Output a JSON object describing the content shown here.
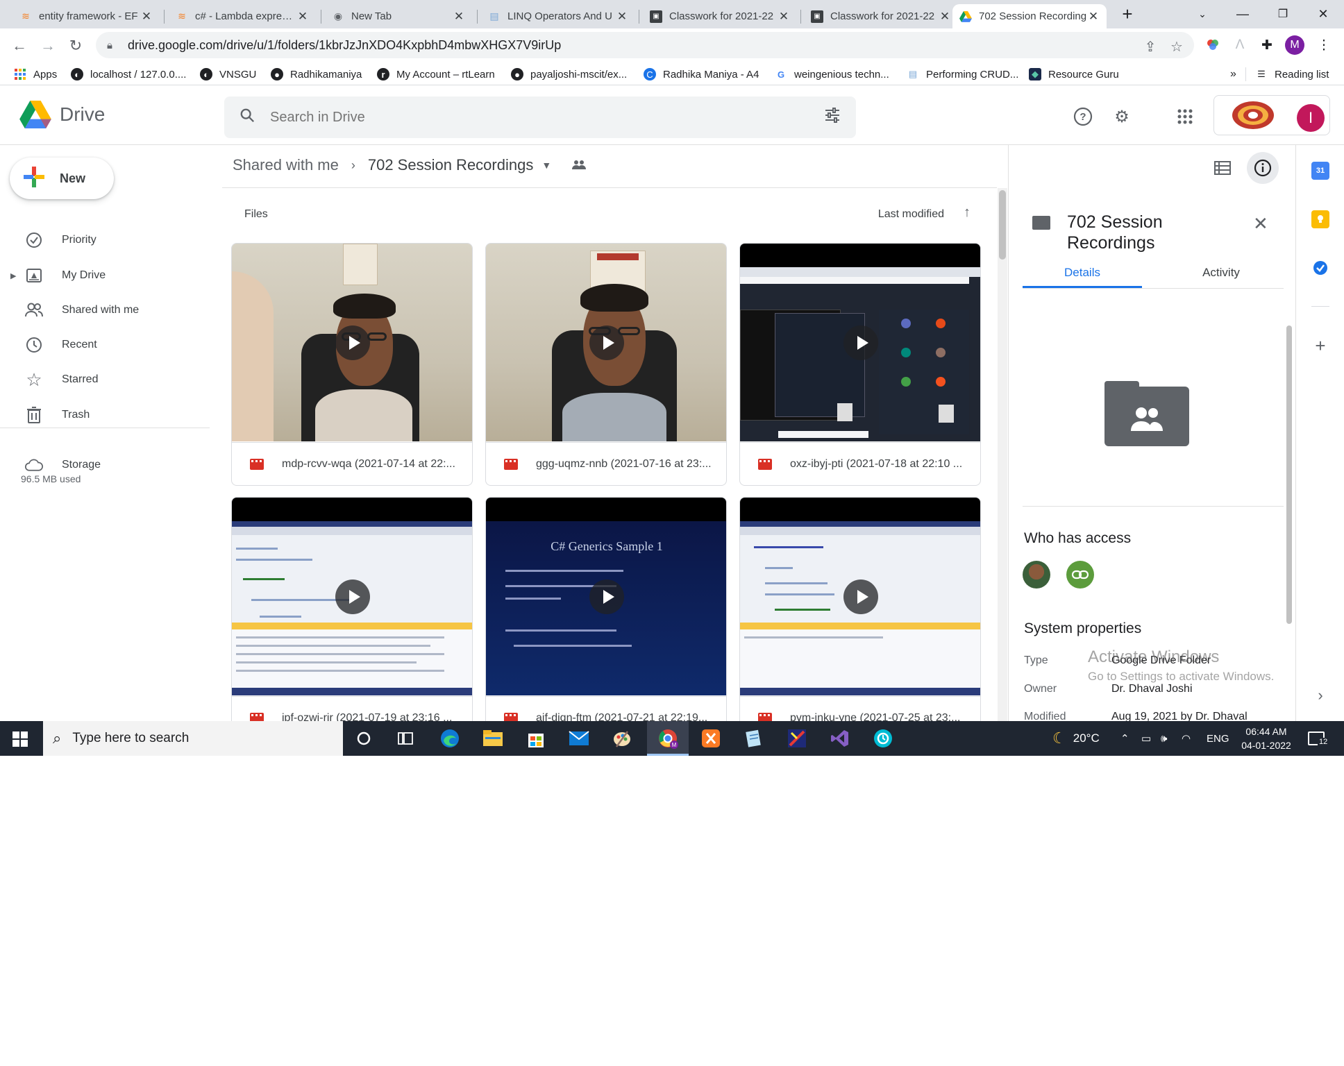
{
  "tabs": [
    {
      "title": "entity framework - EF",
      "favicon": "stackoverflow-icon"
    },
    {
      "title": "c# - Lambda expressio",
      "favicon": "stackoverflow-icon"
    },
    {
      "title": "New Tab",
      "favicon": "chrome-icon"
    },
    {
      "title": "LINQ Operators And U",
      "favicon": "page-icon"
    },
    {
      "title": "Classwork for 2021-22",
      "favicon": "classroom-icon"
    },
    {
      "title": "Classwork for 2021-22",
      "favicon": "classroom-icon"
    },
    {
      "title": "702 Session Recording",
      "favicon": "drive-icon",
      "active": true
    }
  ],
  "address_bar": {
    "url": "drive.google.com/drive/u/1/folders/1kbrJzJnXDO4KxpbhD4mbwXHGX7V9irUp"
  },
  "profile_initial": "M",
  "bookmarks": [
    "Apps",
    "localhost / 127.0.0....",
    "VNSGU",
    "Radhikamaniya",
    "My Account – rtLearn",
    "payaljoshi-mscit/ex...",
    "Radhika Maniya - A4",
    "weingenious techn...",
    "Performing CRUD...",
    "Resource Guru"
  ],
  "bookmarks_overflow": "»",
  "reading_list": "Reading list",
  "drive": {
    "logo_text": "Drive",
    "search_placeholder": "Search in Drive",
    "account_initial": "I"
  },
  "sidebar": {
    "new_label": "New",
    "items": [
      {
        "label": "Priority",
        "icon": "priority-icon"
      },
      {
        "label": "My Drive",
        "icon": "my-drive-icon"
      },
      {
        "label": "Shared with me",
        "icon": "shared-icon"
      },
      {
        "label": "Recent",
        "icon": "clock-icon"
      },
      {
        "label": "Starred",
        "icon": "star-icon"
      },
      {
        "label": "Trash",
        "icon": "trash-icon"
      }
    ],
    "storage_label": "Storage",
    "storage_used": "96.5 MB used"
  },
  "breadcrumb": {
    "parent": "Shared with me",
    "current": "702 Session Recordings"
  },
  "files": {
    "section_label": "Files",
    "sort_label": "Last modified",
    "items": [
      {
        "name": "mdp-rcvv-wqa (2021-07-14 at 22:...",
        "thumb": "person"
      },
      {
        "name": "ggg-uqmz-nnb (2021-07-16 at 23:...",
        "thumb": "person"
      },
      {
        "name": "oxz-ibyj-pti (2021-07-18 at 22:10 ...",
        "thumb": "meeting"
      },
      {
        "name": "ipf-ozwi-rir (2021-07-19 at 23:16 ...",
        "thumb": "ide"
      },
      {
        "name": "aif-diqn-ftm (2021-07-21 at 22:19...",
        "thumb": "slide"
      },
      {
        "name": "pym-jnku-yne (2021-07-25 at 23:...",
        "thumb": "ide"
      }
    ],
    "slide_title": "C# Generics Sample 1"
  },
  "details": {
    "title": "702 Session Recordings",
    "tab_details": "Details",
    "tab_activity": "Activity",
    "who_has_access": "Who has access",
    "system_properties": "System properties",
    "properties": [
      {
        "key": "Type",
        "value": "Google Drive Folder"
      },
      {
        "key": "Owner",
        "value": "Dr. Dhaval Joshi"
      },
      {
        "key": "Modified",
        "value": "Aug 19, 2021 by Dr. Dhaval"
      }
    ],
    "watermark_title": "Activate Windows",
    "watermark_sub": "Go to Settings to activate Windows."
  },
  "taskbar": {
    "search_text": "Type here to search",
    "weather": "20°C",
    "language": "ENG",
    "time": "06:44 AM",
    "date": "04-01-2022",
    "notifications": "12"
  }
}
